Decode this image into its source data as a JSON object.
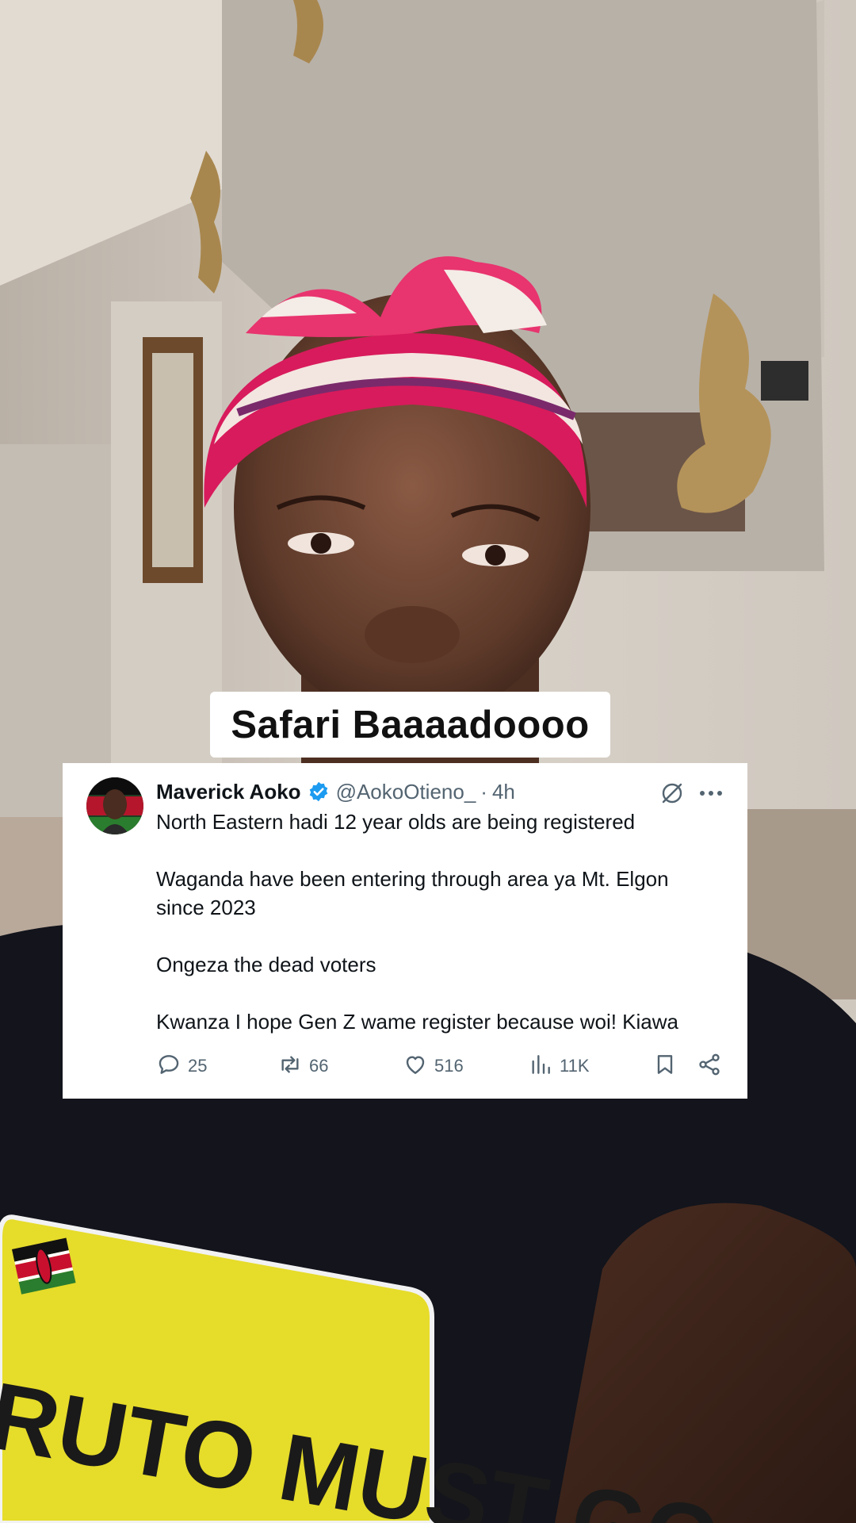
{
  "caption": {
    "text": "Safari Baaaadoooo"
  },
  "shirt_text": "RUTO MUST GO",
  "tweet": {
    "name": "Maverick Aoko",
    "handle": "@AokoOtieno_",
    "separator": "·",
    "time": "4h",
    "lines": [
      "North Eastern hadi 12 year olds are being registered",
      "",
      "Waganda have been entering through area ya Mt. Elgon",
      "since 2023",
      "",
      "Ongeza the dead voters",
      "",
      "Kwanza I hope Gen Z wame register because woi! Kiawa"
    ],
    "replies": "25",
    "retweets": "66",
    "likes": "516",
    "views": "11K"
  },
  "icons": [
    "verified-badge-icon",
    "grok-icon",
    "more-icon",
    "reply-icon",
    "retweet-icon",
    "like-icon",
    "views-icon",
    "bookmark-icon",
    "share-icon"
  ],
  "colors": {
    "verified": "#1d9bf0",
    "text": "#0f1419",
    "secondary": "#536471",
    "shirt_patch": "#e6dc2a",
    "headwrap": "#d81b5c"
  }
}
